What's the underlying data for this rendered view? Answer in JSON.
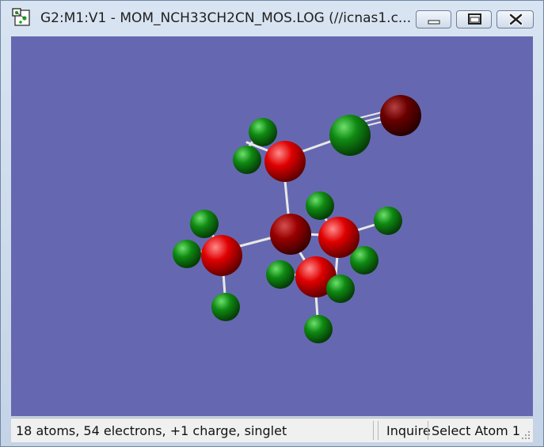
{
  "window": {
    "title": "G2:M1:V1 - MOM_NCH33CH2CN_MOS.LOG (//icnas1.c...",
    "icon": "gaussview-molecule-icon",
    "controls": {
      "minimize": "minimize-icon",
      "maximize": "maximize-icon",
      "close": "close-icon"
    }
  },
  "colors": {
    "background": "#6568b0",
    "hydrogen": "#0f8a12",
    "carbon_bright": "#e00000",
    "carbon_dark": "#9a0000",
    "nitrogen_dark": "#6a0000",
    "bond": "#e8e8e8"
  },
  "statusbar": {
    "summary": "18 atoms, 54 electrons, +1 charge, singlet",
    "mode": "Inquire",
    "selection": "Select Atom 1"
  }
}
